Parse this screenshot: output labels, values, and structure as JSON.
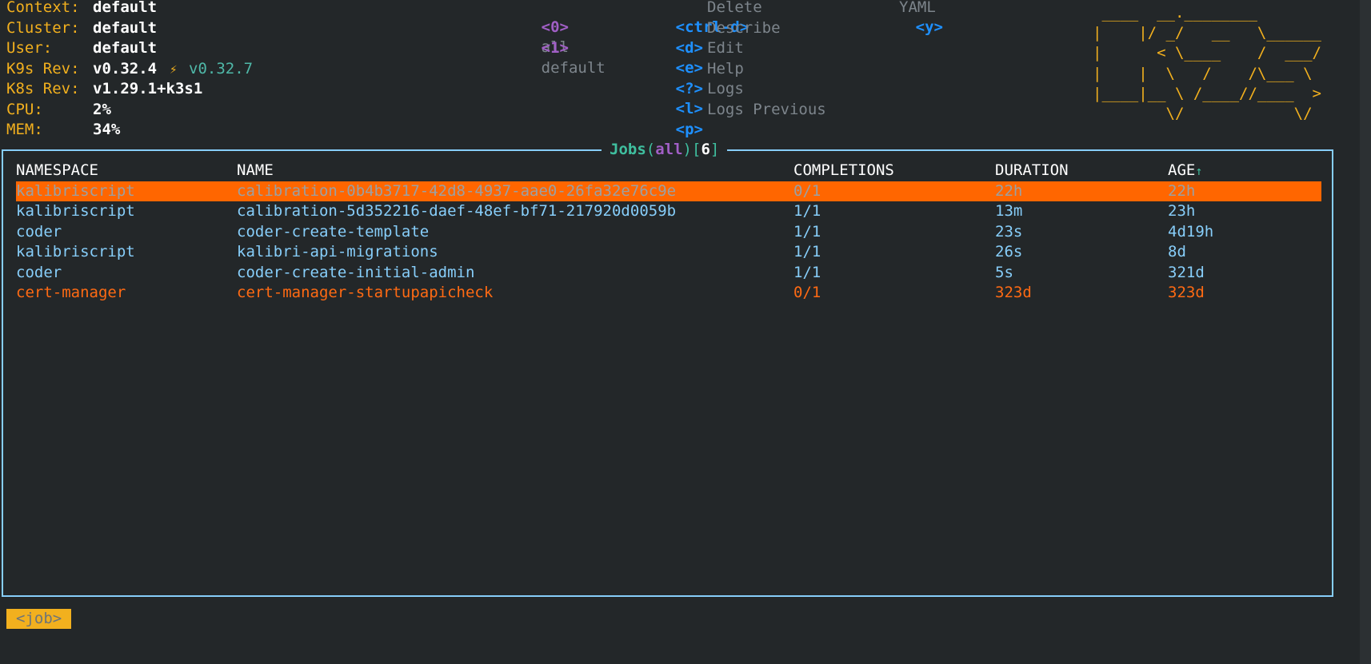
{
  "info": {
    "context_label": "Context:",
    "context_value": "default",
    "cluster_label": "Cluster:",
    "cluster_value": "default",
    "user_label": "User:",
    "user_value": "default",
    "k9s_label": "K9s Rev:",
    "k9s_value": "v0.32.4",
    "k9s_upgrade_icon": "⚡",
    "k9s_upgrade": "v0.32.7",
    "k8s_label": "K8s Rev:",
    "k8s_value": "v1.29.1+k3s1",
    "cpu_label": "CPU:",
    "cpu_value": "2%",
    "mem_label": "MEM:",
    "mem_value": "34%"
  },
  "namespaces": [
    {
      "key": "<0>",
      "label": "all"
    },
    {
      "key": "<1>",
      "label": "default"
    }
  ],
  "actions": [
    {
      "key": "<ctrl-d>",
      "label": "Delete"
    },
    {
      "key": "<d>",
      "label": "Describe"
    },
    {
      "key": "<e>",
      "label": "Edit"
    },
    {
      "key": "<?>",
      "label": "Help"
    },
    {
      "key": "<l>",
      "label": "Logs"
    },
    {
      "key": "<p>",
      "label": "Logs Previous"
    }
  ],
  "actions_col2": [
    {
      "key": "<y>",
      "label": "YAML"
    }
  ],
  "logo": [
    " ____  __.________",
    "|    |/ _/   __   \\______",
    "|      < \\____    /  ___/",
    "|    |  \\   /    /\\___ \\",
    "|____|__ \\ /____//____  >",
    "        \\/            \\/"
  ],
  "table": {
    "resource": "Jobs",
    "paren_open": "(",
    "namespace": "all",
    "paren_close": ")",
    "bracket_open": "[",
    "count": "6",
    "bracket_close": "]",
    "columns": [
      "NAMESPACE",
      "NAME",
      "COMPLETIONS",
      "DURATION",
      "AGE"
    ],
    "sort_icon": "↑",
    "rows": [
      {
        "namespace": "kalibriscript",
        "name": "calibration-0b4b3717-42d8-4937-aae0-26fa32e76c9e",
        "completions": "0/1",
        "duration": "22h",
        "age": "22h",
        "state": "selected"
      },
      {
        "namespace": "kalibriscript",
        "name": "calibration-5d352216-daef-48ef-bf71-217920d0059b",
        "completions": "1/1",
        "duration": "13m",
        "age": "23h",
        "state": "ok"
      },
      {
        "namespace": "coder",
        "name": "coder-create-template",
        "completions": "1/1",
        "duration": "23s",
        "age": "4d19h",
        "state": "ok"
      },
      {
        "namespace": "kalibriscript",
        "name": "kalibri-api-migrations",
        "completions": "1/1",
        "duration": "26s",
        "age": "8d",
        "state": "ok"
      },
      {
        "namespace": "coder",
        "name": "coder-create-initial-admin",
        "completions": "1/1",
        "duration": "5s",
        "age": "321d",
        "state": "ok"
      },
      {
        "namespace": "cert-manager",
        "name": "cert-manager-startupapicheck",
        "completions": "0/1",
        "duration": "323d",
        "age": "323d",
        "state": "fail"
      }
    ]
  },
  "breadcrumb": "<job>",
  "colors": {
    "background": "#232729",
    "label": "#f2b01e",
    "border": "#87cefa",
    "selected": "#ff6600",
    "error": "#ff6a13",
    "key": "#1e90ff",
    "namespace_key": "#a15fc6"
  }
}
